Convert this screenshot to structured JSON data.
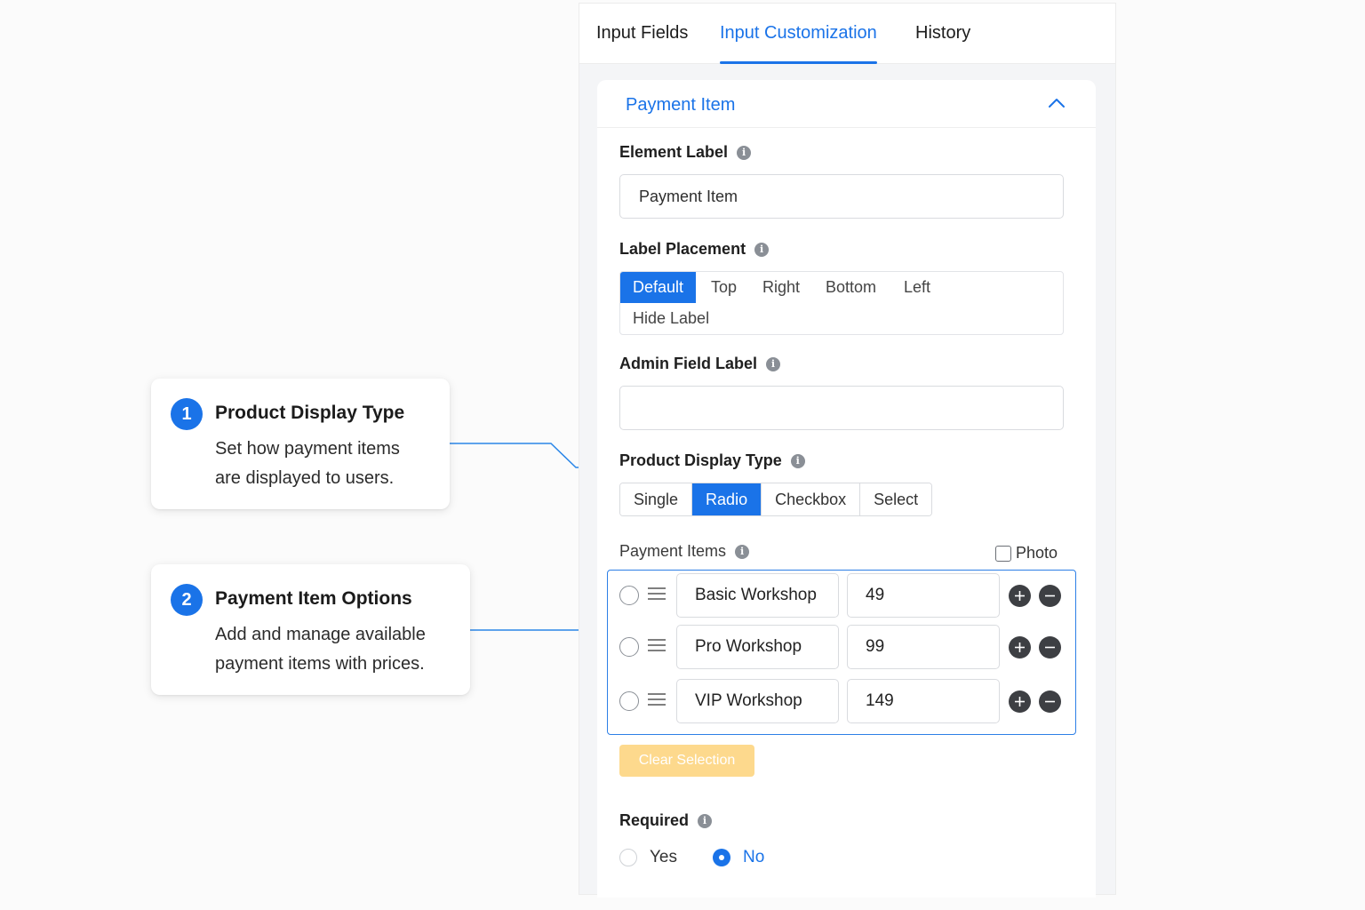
{
  "callouts": [
    {
      "number": "1",
      "title": "Product Display Type",
      "desc_line1": "Set how payment items",
      "desc_line2": "are displayed to users."
    },
    {
      "number": "2",
      "title": "Payment Item Options",
      "desc_line1": "Add and manage available",
      "desc_line2": "payment items with prices."
    }
  ],
  "tabs": [
    {
      "label": "Input Fields",
      "active": false
    },
    {
      "label": "Input Customization",
      "active": true
    },
    {
      "label": "History",
      "active": false
    }
  ],
  "section": {
    "title": "Payment Item",
    "icon": "chevron-up-icon"
  },
  "element_label": {
    "label": "Element Label",
    "value": "Payment Item"
  },
  "label_placement": {
    "label": "Label Placement",
    "options": [
      "Default",
      "Top",
      "Right",
      "Bottom",
      "Left",
      "Hide Label"
    ],
    "selected": "Default"
  },
  "admin_field_label": {
    "label": "Admin Field Label",
    "value": ""
  },
  "product_display_type": {
    "label": "Product Display Type",
    "options": [
      "Single",
      "Radio",
      "Checkbox",
      "Select"
    ],
    "selected": "Radio"
  },
  "payment_items": {
    "label": "Payment Items",
    "photo_label": "Photo",
    "photo_checked": false,
    "rows": [
      {
        "name": "Basic Workshop",
        "price": "49"
      },
      {
        "name": "Pro Workshop",
        "price": "99"
      },
      {
        "name": "VIP Workshop",
        "price": "149"
      }
    ],
    "clear_label": "Clear Selection"
  },
  "required": {
    "label": "Required",
    "options": [
      "Yes",
      "No"
    ],
    "selected": "No"
  },
  "colors": {
    "accent": "#1a73e8",
    "clear_button": "#fdd581"
  }
}
